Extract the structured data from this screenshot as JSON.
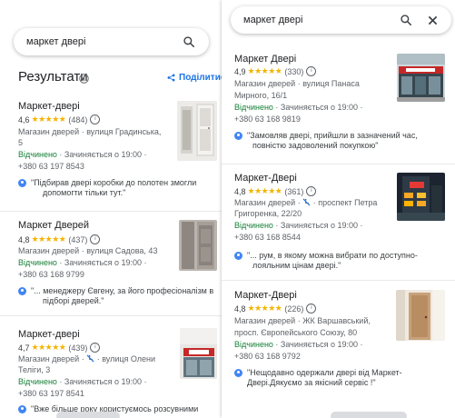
{
  "left": {
    "search": {
      "query": "маркет двері"
    },
    "header": {
      "title": "Результати",
      "share_label": "Поділитис"
    },
    "results": [
      {
        "name": "Маркет-двері",
        "rating": "4,6",
        "stars": "★★★★★",
        "reviews": "(484)",
        "address_1": "Магазин дверей · вулиця Градинська,",
        "address_2": "5",
        "status": "Відчинено",
        "hours": " · Зачиняється о 19:00 ·",
        "phone": "+380 63 197 8543",
        "review_1": "\"Підбирав двері коробки до полотен змогли",
        "review_2": "допомогти тільки тут.\""
      },
      {
        "name": "Маркет Дверей",
        "rating": "4,8",
        "stars": "★★★★★",
        "reviews": "(437)",
        "address_1": "Магазин дверей · вулиця Садова, 43",
        "status": "Відчинено",
        "hours": " · Зачиняється о 19:00 ·",
        "phone": "+380 63 168 9799",
        "review_1": "\"... менеджеру Євгену, за його професіоналізм в",
        "review_2": "підборі дверей.\""
      },
      {
        "name": "Маркет-двері",
        "rating": "4,7",
        "stars": "★★★★★",
        "reviews": "(439)",
        "address_1": "Магазин дверей · ",
        "address_1b": " · вулиця Олени",
        "address_2": "Теліги, 3",
        "status": "Відчинено",
        "hours": " · Зачиняється о 19:00 ·",
        "phone": "+380 63 197 8541",
        "review_1": "\"Вже більше року користуємось розсувними"
      }
    ]
  },
  "right": {
    "search": {
      "query": "маркет двері"
    },
    "results": [
      {
        "name": "Маркет Двері",
        "rating": "4,9",
        "stars": "★★★★★",
        "reviews": "(330)",
        "address_1": "Магазин дверей · вулиця Панаса",
        "address_2": "Мирного, 16/1",
        "status": "Відчинено",
        "hours": " · Зачиняється о 19:00 ·",
        "phone": "+380 63 168 9819",
        "review_1": "\"Замовляв двері, прийшли в зазначений час,",
        "review_2": "повністю задоволений покупкою\""
      },
      {
        "name": "Маркет-Двері",
        "rating": "4,8",
        "stars": "★★★★★",
        "reviews": "(361)",
        "address_1": "Магазин дверей · ",
        "address_1b": " · проспект Петра",
        "address_2": "Григоренка, 22/20",
        "status": "Відчинено",
        "hours": " · Зачиняється о 19:00 ·",
        "phone": "+380 63 168 8544",
        "review_1": "\"... рум, в якому можна вибрати по доступно-",
        "review_2": "лояльним цінам двері.\""
      },
      {
        "name": "Маркет-Двері",
        "rating": "4,8",
        "stars": "★★★★★",
        "reviews": "(226)",
        "address_1": "Магазин дверей · ЖК Варшавський,",
        "address_2": "просп. Європейського Союзу, 80",
        "status": "Відчинено",
        "hours": " · Зачиняється о 19:00 ·",
        "phone": "+380 63 168 9792",
        "review_1": "\"Нещодавно одержали двері від Маркет-",
        "review_2": "Двері.Дякуємо за якісний сервіс !\""
      }
    ]
  },
  "colors": {
    "accent": "#1a73e8",
    "open": "#188038",
    "star": "#f4b400",
    "text": "#202124",
    "muted": "#5f6368"
  },
  "icons": [
    "search-icon",
    "close-icon",
    "info-icon",
    "share-icon",
    "no-wheelchair-icon",
    "reviewer-avatar-icon"
  ]
}
